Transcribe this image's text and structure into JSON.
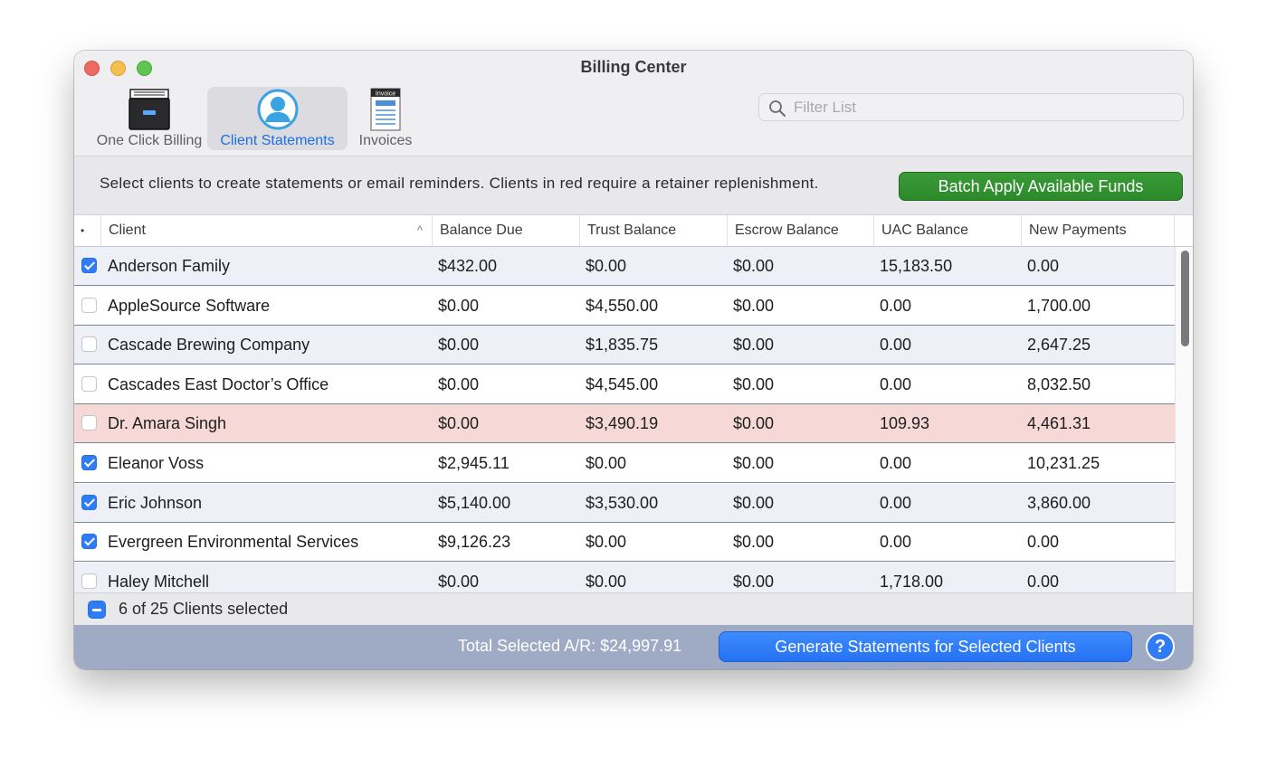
{
  "window": {
    "title": "Billing Center"
  },
  "toolbar": {
    "items": [
      {
        "label": "One Click Billing",
        "icon": "file-drawer-icon",
        "selected": false
      },
      {
        "label": "Client Statements",
        "icon": "person-icon",
        "selected": true
      },
      {
        "label": "Invoices",
        "icon": "invoice-icon",
        "icon_text": "Invoice",
        "selected": false
      }
    ],
    "search": {
      "placeholder": "Filter List",
      "value": ""
    }
  },
  "instructions": {
    "text": "Select clients to create statements or email reminders. Clients in red require a retainer replenishment.",
    "batch_button": "Batch Apply Available Funds"
  },
  "table": {
    "columns": [
      {
        "label": "•"
      },
      {
        "label": "Client",
        "sorted": "ascending"
      },
      {
        "label": "Balance Due"
      },
      {
        "label": "Trust Balance"
      },
      {
        "label": "Escrow Balance"
      },
      {
        "label": "UAC Balance"
      },
      {
        "label": "New Payments"
      }
    ],
    "rows": [
      {
        "checked": true,
        "needs_replenishment": false,
        "client": "Anderson Family",
        "balance_due": "$432.00",
        "trust": "$0.00",
        "escrow": "$0.00",
        "uac": "15,183.50",
        "new_payments": "0.00"
      },
      {
        "checked": false,
        "needs_replenishment": false,
        "client": "AppleSource Software",
        "balance_due": "$0.00",
        "trust": "$4,550.00",
        "escrow": "$0.00",
        "uac": "0.00",
        "new_payments": "1,700.00"
      },
      {
        "checked": false,
        "needs_replenishment": false,
        "client": "Cascade Brewing Company",
        "balance_due": "$0.00",
        "trust": "$1,835.75",
        "escrow": "$0.00",
        "uac": "0.00",
        "new_payments": "2,647.25"
      },
      {
        "checked": false,
        "needs_replenishment": false,
        "client": "Cascades East Doctor’s Office",
        "balance_due": "$0.00",
        "trust": "$4,545.00",
        "escrow": "$0.00",
        "uac": "0.00",
        "new_payments": "8,032.50"
      },
      {
        "checked": false,
        "needs_replenishment": true,
        "client": "Dr. Amara Singh",
        "balance_due": "$0.00",
        "trust": "$3,490.19",
        "escrow": "$0.00",
        "uac": "109.93",
        "new_payments": "4,461.31"
      },
      {
        "checked": true,
        "needs_replenishment": false,
        "client": "Eleanor Voss",
        "balance_due": "$2,945.11",
        "trust": "$0.00",
        "escrow": "$0.00",
        "uac": "0.00",
        "new_payments": "10,231.25"
      },
      {
        "checked": true,
        "needs_replenishment": false,
        "client": "Eric Johnson",
        "balance_due": "$5,140.00",
        "trust": "$3,530.00",
        "escrow": "$0.00",
        "uac": "0.00",
        "new_payments": "3,860.00"
      },
      {
        "checked": true,
        "needs_replenishment": false,
        "client": "Evergreen Environmental Services",
        "balance_due": "$9,126.23",
        "trust": "$0.00",
        "escrow": "$0.00",
        "uac": "0.00",
        "new_payments": "0.00"
      },
      {
        "checked": false,
        "needs_replenishment": false,
        "client": "Haley Mitchell",
        "balance_due": "$0.00",
        "trust": "$0.00",
        "escrow": "$0.00",
        "uac": "1,718.00",
        "new_payments": "0.00"
      }
    ]
  },
  "selection": {
    "text": "6 of 25 Clients selected",
    "state": "mixed"
  },
  "footer": {
    "total_text": "Total Selected A/R: $24,997.91",
    "generate_button": "Generate Statements for Selected Clients",
    "help_label": "?"
  },
  "colors": {
    "accent": "#2f7cf6",
    "batch_button": "#2c8a2a",
    "alert_row": "#f6d9d6",
    "footer_bar": "#9fabc4"
  }
}
